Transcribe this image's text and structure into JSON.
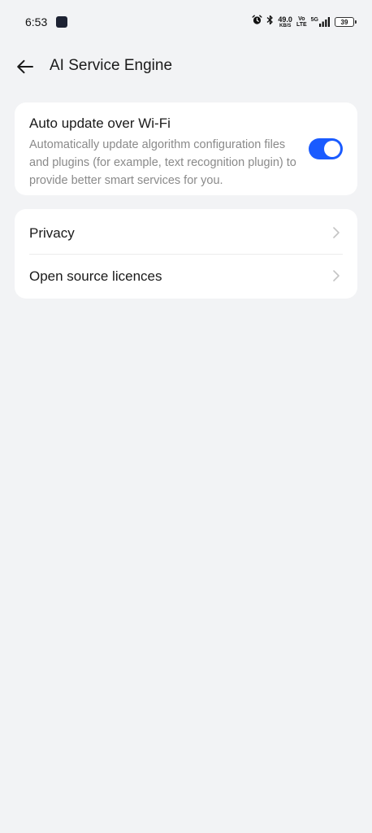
{
  "status_bar": {
    "time": "6:53",
    "net_speed": "49.0",
    "net_speed_unit": "KB/S",
    "volte_top": "Vo",
    "volte_bottom": "LTE",
    "network_type": "5G",
    "battery": "39"
  },
  "header": {
    "title": "AI Service Engine"
  },
  "auto_update": {
    "title": "Auto update over Wi-Fi",
    "description": "Automatically update algorithm configuration files and plugins (for example, text recognition plugin) to provide better smart services for you.",
    "enabled": true
  },
  "menu": {
    "items": [
      {
        "label": "Privacy"
      },
      {
        "label": "Open source licences"
      }
    ]
  },
  "colors": {
    "accent": "#1a5bff",
    "background": "#f2f3f5",
    "card": "#ffffff"
  }
}
